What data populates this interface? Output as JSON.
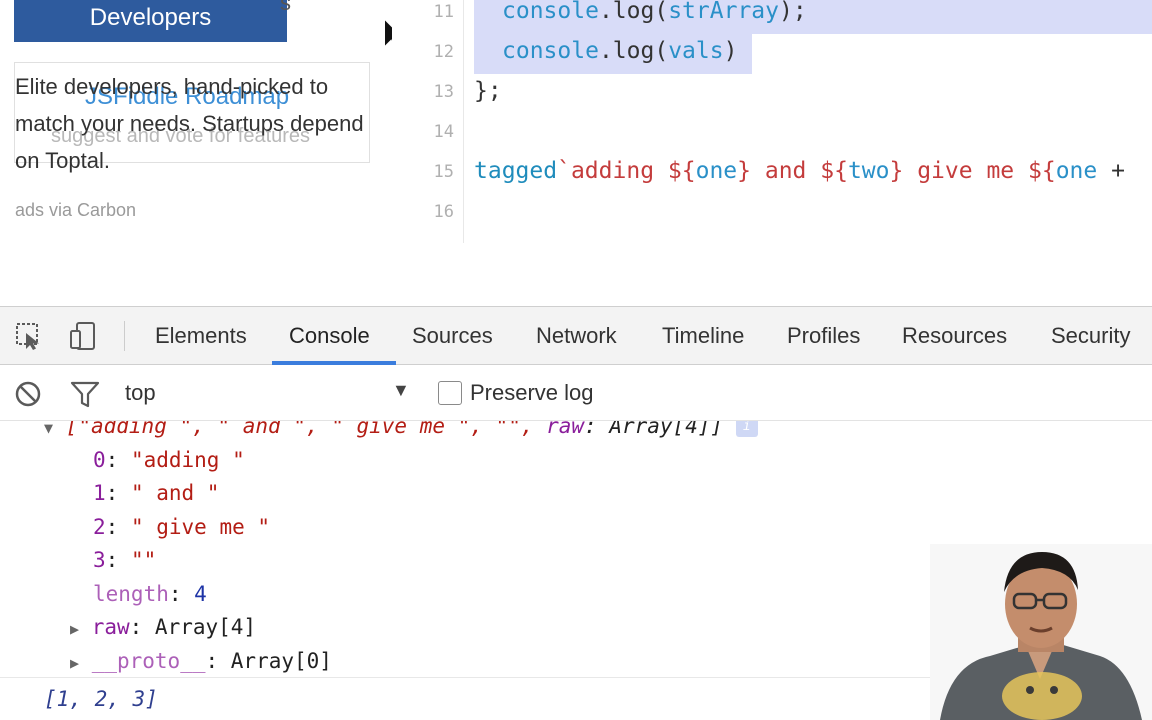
{
  "ad": {
    "banner": "Developers",
    "banner_tail": "s",
    "roadmap_title": "JSFiddle Roadmap",
    "roadmap_sub": "suggest and vote for features",
    "text": "Elite developers, hand-picked to match your needs. Startups depend on Toptal.",
    "via": "ads via Carbon"
  },
  "editor": {
    "line_numbers": [
      "11",
      "12",
      "13",
      "14",
      "15",
      "16"
    ],
    "line11": {
      "obj": "console",
      "dot": ".",
      "method": "log",
      "open": "(",
      "arg": "strArray",
      "close": ");"
    },
    "line12": {
      "obj": "console",
      "dot": ".",
      "method": "log",
      "open": "(",
      "arg": "vals",
      "close": ")"
    },
    "line13": "};",
    "line15": {
      "tag": "tagged",
      "tick": "`",
      "s1": "adding ",
      "o1": "${",
      "v1": "one",
      "c1": "}",
      "s2": " and ",
      "o2": "${",
      "v2": "two",
      "c2": "}",
      "s3": " give me ",
      "o3": "${",
      "v3": "one",
      "tail": " +"
    }
  },
  "devtools": {
    "tabs": [
      "Elements",
      "Console",
      "Sources",
      "Network",
      "Timeline",
      "Profiles",
      "Resources",
      "Security"
    ],
    "active_tab": "Console",
    "context": "top",
    "preserve_log": "Preserve log",
    "console": {
      "summary": [
        "[\"adding \", \" and \", \" give me \", \"\", ",
        "raw",
        ": Array[4]]"
      ],
      "items": [
        {
          "key": "0",
          "value": "\"adding \""
        },
        {
          "key": "1",
          "value": "\" and \""
        },
        {
          "key": "2",
          "value": "\" give me \""
        },
        {
          "key": "3",
          "value": "\"\""
        }
      ],
      "length_key": "length",
      "length_value": "4",
      "raw_key": "raw",
      "raw_value": "Array[4]",
      "proto_key": "__proto__",
      "proto_value": "Array[0]",
      "result": "[1, 2, 3]",
      "info_badge": "i"
    }
  },
  "colors": {
    "accent": "#3b7ddd",
    "banner": "#2e5b9e",
    "selection": "#d8dcf8"
  }
}
